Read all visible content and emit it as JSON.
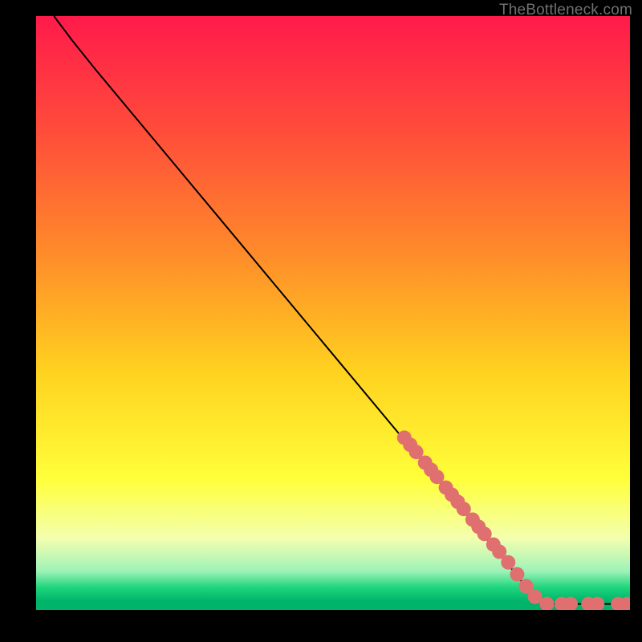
{
  "attribution": "TheBottleneck.com",
  "chart_data": {
    "type": "line",
    "title": "",
    "xlabel": "",
    "ylabel": "",
    "x_range": [
      0,
      100
    ],
    "y_range": [
      0,
      100
    ],
    "background_gradient_stops": [
      {
        "offset": 0.0,
        "color": "#ff1a4b"
      },
      {
        "offset": 0.2,
        "color": "#ff4e3a"
      },
      {
        "offset": 0.4,
        "color": "#ff8b2a"
      },
      {
        "offset": 0.6,
        "color": "#ffd21f"
      },
      {
        "offset": 0.78,
        "color": "#ffff3a"
      },
      {
        "offset": 0.88,
        "color": "#f3ffaf"
      },
      {
        "offset": 0.935,
        "color": "#9df2b8"
      },
      {
        "offset": 0.962,
        "color": "#1fd67d"
      },
      {
        "offset": 0.985,
        "color": "#00b46a"
      },
      {
        "offset": 1.0,
        "color": "#00b46a"
      }
    ],
    "curve": [
      {
        "x": 3,
        "y": 100
      },
      {
        "x": 6,
        "y": 96
      },
      {
        "x": 10,
        "y": 91
      },
      {
        "x": 15,
        "y": 85
      },
      {
        "x": 20,
        "y": 79
      },
      {
        "x": 30,
        "y": 67
      },
      {
        "x": 40,
        "y": 55
      },
      {
        "x": 50,
        "y": 43
      },
      {
        "x": 60,
        "y": 31
      },
      {
        "x": 70,
        "y": 19
      },
      {
        "x": 80,
        "y": 7
      },
      {
        "x": 84,
        "y": 2
      },
      {
        "x": 86,
        "y": 1
      },
      {
        "x": 90,
        "y": 1
      },
      {
        "x": 95,
        "y": 1
      },
      {
        "x": 100,
        "y": 1
      }
    ],
    "highlighted_points": [
      {
        "x": 62,
        "y": 29
      },
      {
        "x": 63,
        "y": 27.8
      },
      {
        "x": 64,
        "y": 26.6
      },
      {
        "x": 65.5,
        "y": 24.8
      },
      {
        "x": 66.5,
        "y": 23.6
      },
      {
        "x": 67.5,
        "y": 22.4
      },
      {
        "x": 69,
        "y": 20.6
      },
      {
        "x": 70,
        "y": 19.4
      },
      {
        "x": 71,
        "y": 18.2
      },
      {
        "x": 72,
        "y": 17.0
      },
      {
        "x": 73.5,
        "y": 15.2
      },
      {
        "x": 74.5,
        "y": 14.0
      },
      {
        "x": 75.5,
        "y": 12.8
      },
      {
        "x": 77,
        "y": 11.0
      },
      {
        "x": 78,
        "y": 9.8
      },
      {
        "x": 79.5,
        "y": 8.0
      },
      {
        "x": 81,
        "y": 6.0
      },
      {
        "x": 82.5,
        "y": 4.0
      },
      {
        "x": 84,
        "y": 2.2
      },
      {
        "x": 86,
        "y": 1.0
      },
      {
        "x": 88.5,
        "y": 1.0
      },
      {
        "x": 90,
        "y": 1.0
      },
      {
        "x": 93,
        "y": 1.0
      },
      {
        "x": 94.5,
        "y": 1.0
      },
      {
        "x": 98,
        "y": 1.0
      },
      {
        "x": 99.5,
        "y": 1.0
      }
    ],
    "marker_color": "#e07070",
    "marker_radius_px": 9,
    "line_color": "#000000"
  }
}
